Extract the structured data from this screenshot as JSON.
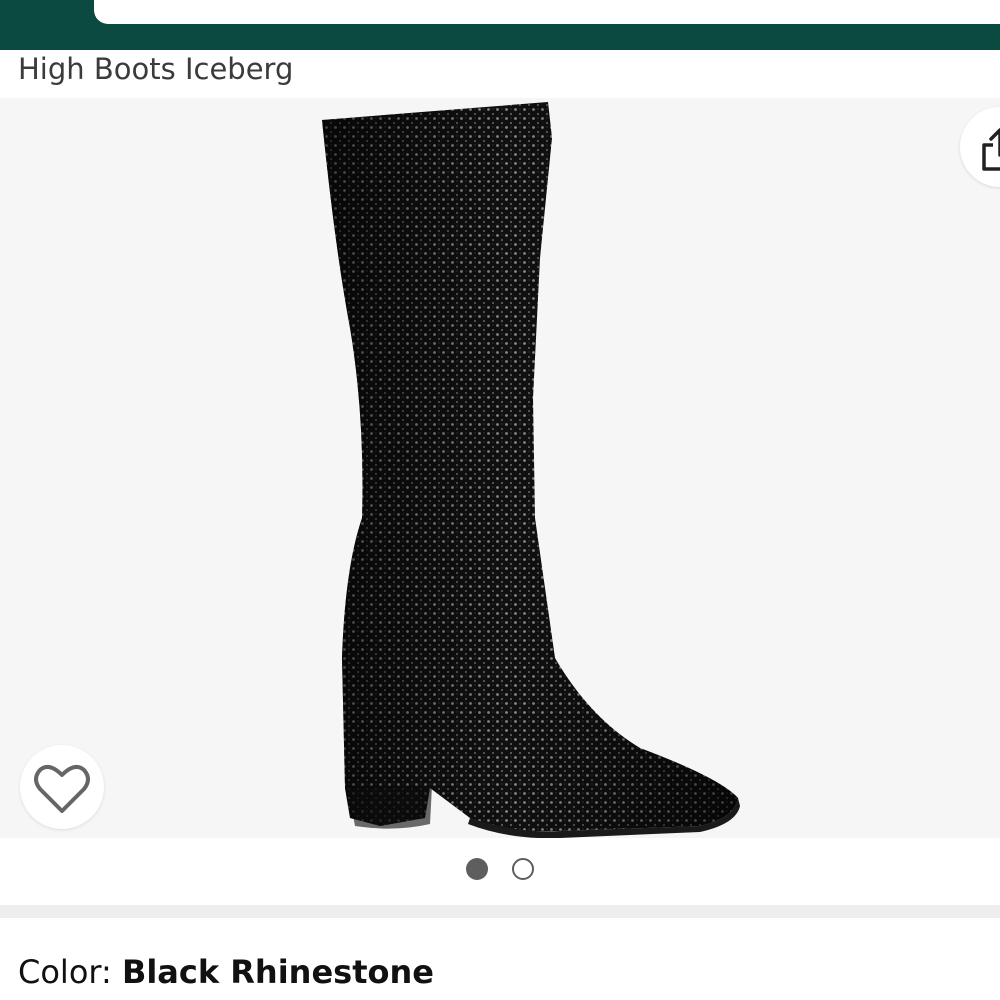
{
  "header": {
    "background_color": "#0b4a40",
    "search_field_value": ""
  },
  "product": {
    "title": "High Boots Iceberg",
    "image_alt": "Black rhinestone knee-high boot with pointed toe and block heel"
  },
  "actions": {
    "share_icon": "share-icon",
    "wishlist_icon": "heart-icon"
  },
  "carousel": {
    "total_images": 2,
    "active_index": 0
  },
  "variant": {
    "color_label": "Color: ",
    "color_value": "Black Rhinestone"
  }
}
